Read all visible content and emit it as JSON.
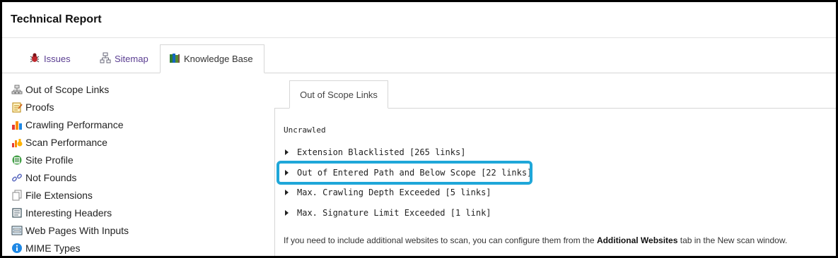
{
  "window": {
    "title": "Technical Report"
  },
  "tabs": [
    {
      "label": "Issues",
      "icon": "bug-icon"
    },
    {
      "label": "Sitemap",
      "icon": "sitemap-icon"
    },
    {
      "label": "Knowledge Base",
      "icon": "books-icon",
      "active": true
    }
  ],
  "sidebar": {
    "items": [
      {
        "label": "Out of Scope Links",
        "icon": "sitemap-icon"
      },
      {
        "label": "Proofs",
        "icon": "notepad-icon"
      },
      {
        "label": "Crawling Performance",
        "icon": "bar-chart-icon"
      },
      {
        "label": "Scan Performance",
        "icon": "chart-thumb-icon"
      },
      {
        "label": "Site Profile",
        "icon": "profile-icon"
      },
      {
        "label": "Not Founds",
        "icon": "broken-link-icon"
      },
      {
        "label": "File Extensions",
        "icon": "files-icon"
      },
      {
        "label": "Interesting Headers",
        "icon": "document-icon"
      },
      {
        "label": "Web Pages With Inputs",
        "icon": "form-icon"
      },
      {
        "label": "MIME Types",
        "icon": "info-icon"
      }
    ]
  },
  "content": {
    "tab_label": "Out of Scope Links",
    "section_title": "Uncrawled",
    "rows": [
      {
        "label": "Extension Blacklisted [265 links]"
      },
      {
        "label": "Out of Entered Path and Below Scope [22 links]",
        "highlighted": true
      },
      {
        "label": "Max. Crawling Depth Exceeded [5 links]"
      },
      {
        "label": "Max. Signature Limit Exceeded [1 link]"
      }
    ],
    "note": {
      "before": "If you need to include additional websites to scan, you can configure them from the ",
      "link": "Additional Websites",
      "after": " tab in the New scan window."
    }
  },
  "colors": {
    "highlight": "#1fa7d9",
    "tab_link": "#5a3d91"
  }
}
